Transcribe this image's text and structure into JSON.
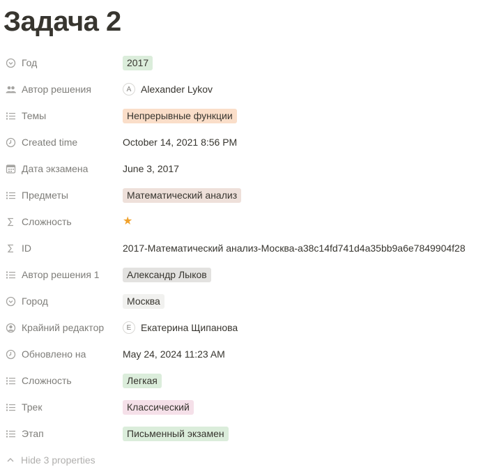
{
  "page": {
    "title": "Задача 2"
  },
  "properties": [
    {
      "name": "Год",
      "icon": "select-icon",
      "type": "tag",
      "value": "2017",
      "color": "#dbeddb"
    },
    {
      "name": "Автор решения",
      "icon": "people-icon",
      "type": "person",
      "avatar": "A",
      "value": "Alexander Lykov"
    },
    {
      "name": "Темы",
      "icon": "list-icon",
      "type": "tag",
      "value": "Непрерывные функции",
      "color": "#fadec9"
    },
    {
      "name": "Created time",
      "icon": "clock-icon",
      "type": "text",
      "value": "October 14, 2021 8:56 PM"
    },
    {
      "name": "Дата экзамена",
      "icon": "calendar-icon",
      "type": "text",
      "value": "June 3, 2017"
    },
    {
      "name": "Предметы",
      "icon": "list-icon",
      "type": "tag",
      "value": "Математический анализ",
      "color": "#eee0da"
    },
    {
      "name": "Сложность",
      "icon": "sigma-icon",
      "type": "star",
      "value": "★"
    },
    {
      "name": "ID",
      "icon": "sigma-icon",
      "type": "text",
      "value": "2017-Математический анализ-Москва-a38c14fd741d4a35bb9a6e7849904f28"
    },
    {
      "name": "Автор решения 1",
      "icon": "list-icon",
      "type": "tag",
      "value": "Александр Лыков",
      "color": "#e3e2e0"
    },
    {
      "name": "Город",
      "icon": "select-icon",
      "type": "tag",
      "value": "Москва",
      "color": "#f1f1ef"
    },
    {
      "name": "Крайний редактор",
      "icon": "person-circle-icon",
      "type": "person",
      "avatar": "E",
      "value": "Екатерина Щипанова"
    },
    {
      "name": "Обновлено на",
      "icon": "clock-icon",
      "type": "text",
      "value": "May 24, 2024 11:23 AM"
    },
    {
      "name": "Сложность",
      "icon": "list-icon",
      "type": "tag",
      "value": "Легкая",
      "color": "#dbeddb"
    },
    {
      "name": "Трек",
      "icon": "list-icon",
      "type": "tag",
      "value": "Классический",
      "color": "#f5e0e9"
    },
    {
      "name": "Этап",
      "icon": "list-icon",
      "type": "tag",
      "value": "Письменный экзамен",
      "color": "#dbeddb"
    }
  ],
  "footer": {
    "hide_label": "Hide 3 properties",
    "hide_icon": "chevron-up-icon"
  },
  "colors": {
    "text": "#37352f",
    "muted": "#8c8b87",
    "star": "#f0a12b"
  }
}
